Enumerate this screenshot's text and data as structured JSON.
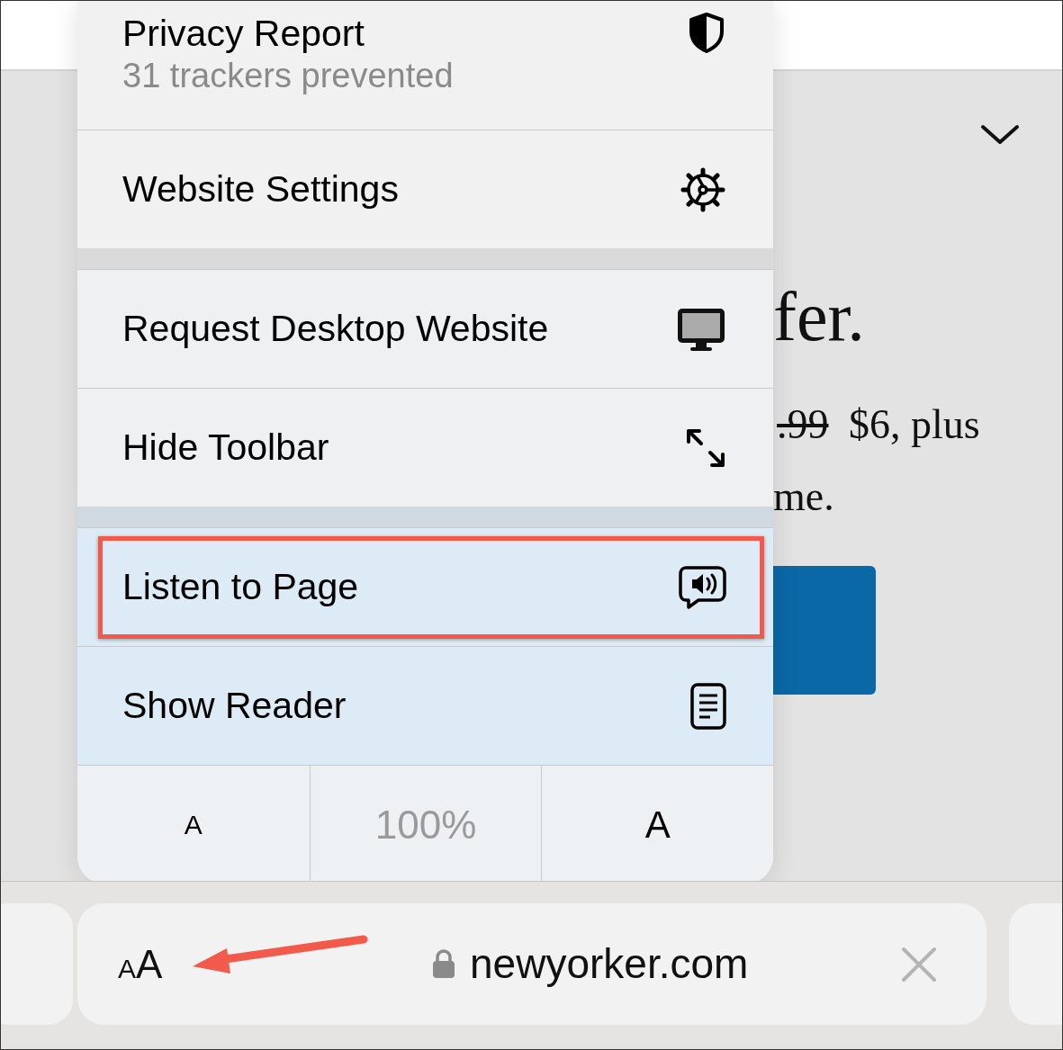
{
  "page": {
    "headline": "fer.",
    "price_old": ".99",
    "price_old_struck": true,
    "price_new": "$6, plus",
    "line_2": "me."
  },
  "menu": {
    "groups": [
      [
        {
          "label": "Privacy Report",
          "detail": "31 trackers prevented",
          "annotated": false
        },
        {
          "label": "Website Settings",
          "annotated": false
        }
      ],
      [
        {
          "label": "Request Desktop Website",
          "annotated": false
        },
        {
          "label": "Hide Toolbar",
          "annotated": false
        }
      ],
      [
        {
          "label": "Listen to Page",
          "annotated": true
        },
        {
          "label": "Show Reader",
          "annotated": false
        }
      ]
    ],
    "font_controls": [
      {
        "kind": "smaller",
        "label": "A"
      },
      {
        "kind": "reading",
        "label": "100%"
      },
      {
        "kind": "larger",
        "label": "A"
      }
    ]
  },
  "address_bar": {
    "text_size_small": "A",
    "text_size_large": "A",
    "annotated": true,
    "url": "newyorker.com"
  }
}
